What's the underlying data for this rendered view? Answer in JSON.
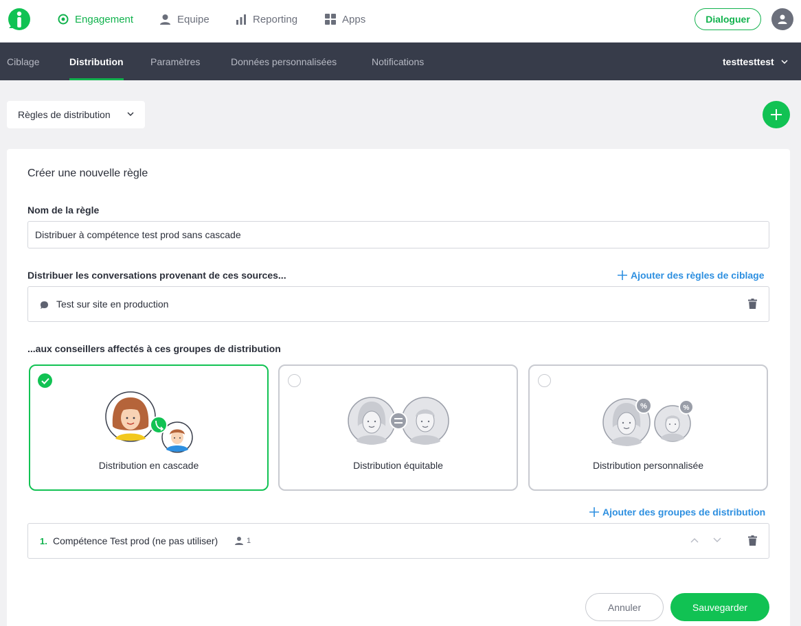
{
  "topnav": {
    "items": [
      {
        "label": "Engagement",
        "icon": "target-icon"
      },
      {
        "label": "Equipe",
        "icon": "person-icon"
      },
      {
        "label": "Reporting",
        "icon": "bar-chart-icon"
      },
      {
        "label": "Apps",
        "icon": "grid-icon"
      }
    ],
    "dialoguer_label": "Dialoguer"
  },
  "subnav": {
    "tabs": [
      {
        "label": "Ciblage"
      },
      {
        "label": "Distribution"
      },
      {
        "label": "Paramètres"
      },
      {
        "label": "Données personnalisées"
      },
      {
        "label": "Notifications"
      }
    ],
    "active_tab": "Distribution",
    "user": "testtesttest"
  },
  "rules_dropdown": {
    "label": "Règles de distribution"
  },
  "form": {
    "title": "Créer une nouvelle règle",
    "name_label": "Nom de la règle",
    "name_value": "Distribuer à compétence test prod sans cascade",
    "sources_label": "Distribuer les conversations provenant de ces sources...",
    "add_targeting_label": "Ajouter des règles de ciblage",
    "sources": [
      {
        "label": "Test sur site en production"
      }
    ],
    "groups_label": "...aux conseillers affectés à ces groupes de distribution",
    "options": [
      {
        "label": "Distribution en cascade",
        "selected": true
      },
      {
        "label": "Distribution équitable",
        "selected": false
      },
      {
        "label": "Distribution personnalisée",
        "selected": false
      }
    ],
    "add_groups_label": "Ajouter des groupes de distribution",
    "groups": [
      {
        "number": "1.",
        "name": "Compétence Test prod (ne pas utiliser)",
        "members": "1"
      }
    ],
    "cancel_label": "Annuler",
    "save_label": "Sauvegarder"
  },
  "colors": {
    "accent_green": "#11c253",
    "link_blue": "#2d8fe0",
    "subnav_bg": "#373c4a"
  }
}
